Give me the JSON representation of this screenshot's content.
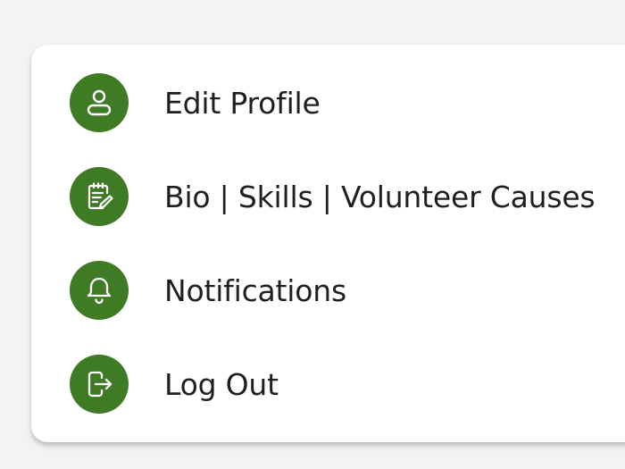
{
  "menu": {
    "accent_color": "#3f7a25",
    "items": [
      {
        "label": "Edit Profile",
        "icon": "user-icon"
      },
      {
        "label": "Bio | Skills | Volunteer Causes",
        "icon": "notepad-edit-icon"
      },
      {
        "label": "Notifications",
        "icon": "bell-icon"
      },
      {
        "label": "Log Out",
        "icon": "logout-icon"
      }
    ]
  }
}
